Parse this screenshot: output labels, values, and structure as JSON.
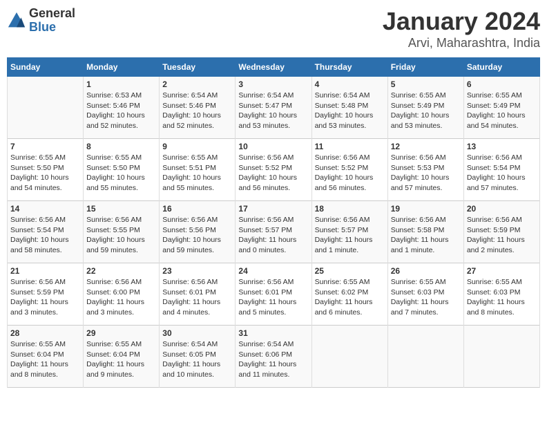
{
  "logo": {
    "general": "General",
    "blue": "Blue"
  },
  "title": "January 2024",
  "subtitle": "Arvi, Maharashtra, India",
  "days_header": [
    "Sunday",
    "Monday",
    "Tuesday",
    "Wednesday",
    "Thursday",
    "Friday",
    "Saturday"
  ],
  "weeks": [
    [
      {
        "day": "",
        "content": ""
      },
      {
        "day": "1",
        "content": "Sunrise: 6:53 AM\nSunset: 5:46 PM\nDaylight: 10 hours\nand 52 minutes."
      },
      {
        "day": "2",
        "content": "Sunrise: 6:54 AM\nSunset: 5:46 PM\nDaylight: 10 hours\nand 52 minutes."
      },
      {
        "day": "3",
        "content": "Sunrise: 6:54 AM\nSunset: 5:47 PM\nDaylight: 10 hours\nand 53 minutes."
      },
      {
        "day": "4",
        "content": "Sunrise: 6:54 AM\nSunset: 5:48 PM\nDaylight: 10 hours\nand 53 minutes."
      },
      {
        "day": "5",
        "content": "Sunrise: 6:55 AM\nSunset: 5:49 PM\nDaylight: 10 hours\nand 53 minutes."
      },
      {
        "day": "6",
        "content": "Sunrise: 6:55 AM\nSunset: 5:49 PM\nDaylight: 10 hours\nand 54 minutes."
      }
    ],
    [
      {
        "day": "7",
        "content": "Sunrise: 6:55 AM\nSunset: 5:50 PM\nDaylight: 10 hours\nand 54 minutes."
      },
      {
        "day": "8",
        "content": "Sunrise: 6:55 AM\nSunset: 5:50 PM\nDaylight: 10 hours\nand 55 minutes."
      },
      {
        "day": "9",
        "content": "Sunrise: 6:55 AM\nSunset: 5:51 PM\nDaylight: 10 hours\nand 55 minutes."
      },
      {
        "day": "10",
        "content": "Sunrise: 6:56 AM\nSunset: 5:52 PM\nDaylight: 10 hours\nand 56 minutes."
      },
      {
        "day": "11",
        "content": "Sunrise: 6:56 AM\nSunset: 5:52 PM\nDaylight: 10 hours\nand 56 minutes."
      },
      {
        "day": "12",
        "content": "Sunrise: 6:56 AM\nSunset: 5:53 PM\nDaylight: 10 hours\nand 57 minutes."
      },
      {
        "day": "13",
        "content": "Sunrise: 6:56 AM\nSunset: 5:54 PM\nDaylight: 10 hours\nand 57 minutes."
      }
    ],
    [
      {
        "day": "14",
        "content": "Sunrise: 6:56 AM\nSunset: 5:54 PM\nDaylight: 10 hours\nand 58 minutes."
      },
      {
        "day": "15",
        "content": "Sunrise: 6:56 AM\nSunset: 5:55 PM\nDaylight: 10 hours\nand 59 minutes."
      },
      {
        "day": "16",
        "content": "Sunrise: 6:56 AM\nSunset: 5:56 PM\nDaylight: 10 hours\nand 59 minutes."
      },
      {
        "day": "17",
        "content": "Sunrise: 6:56 AM\nSunset: 5:57 PM\nDaylight: 11 hours\nand 0 minutes."
      },
      {
        "day": "18",
        "content": "Sunrise: 6:56 AM\nSunset: 5:57 PM\nDaylight: 11 hours\nand 1 minute."
      },
      {
        "day": "19",
        "content": "Sunrise: 6:56 AM\nSunset: 5:58 PM\nDaylight: 11 hours\nand 1 minute."
      },
      {
        "day": "20",
        "content": "Sunrise: 6:56 AM\nSunset: 5:59 PM\nDaylight: 11 hours\nand 2 minutes."
      }
    ],
    [
      {
        "day": "21",
        "content": "Sunrise: 6:56 AM\nSunset: 5:59 PM\nDaylight: 11 hours\nand 3 minutes."
      },
      {
        "day": "22",
        "content": "Sunrise: 6:56 AM\nSunset: 6:00 PM\nDaylight: 11 hours\nand 3 minutes."
      },
      {
        "day": "23",
        "content": "Sunrise: 6:56 AM\nSunset: 6:01 PM\nDaylight: 11 hours\nand 4 minutes."
      },
      {
        "day": "24",
        "content": "Sunrise: 6:56 AM\nSunset: 6:01 PM\nDaylight: 11 hours\nand 5 minutes."
      },
      {
        "day": "25",
        "content": "Sunrise: 6:55 AM\nSunset: 6:02 PM\nDaylight: 11 hours\nand 6 minutes."
      },
      {
        "day": "26",
        "content": "Sunrise: 6:55 AM\nSunset: 6:03 PM\nDaylight: 11 hours\nand 7 minutes."
      },
      {
        "day": "27",
        "content": "Sunrise: 6:55 AM\nSunset: 6:03 PM\nDaylight: 11 hours\nand 8 minutes."
      }
    ],
    [
      {
        "day": "28",
        "content": "Sunrise: 6:55 AM\nSunset: 6:04 PM\nDaylight: 11 hours\nand 8 minutes."
      },
      {
        "day": "29",
        "content": "Sunrise: 6:55 AM\nSunset: 6:04 PM\nDaylight: 11 hours\nand 9 minutes."
      },
      {
        "day": "30",
        "content": "Sunrise: 6:54 AM\nSunset: 6:05 PM\nDaylight: 11 hours\nand 10 minutes."
      },
      {
        "day": "31",
        "content": "Sunrise: 6:54 AM\nSunset: 6:06 PM\nDaylight: 11 hours\nand 11 minutes."
      },
      {
        "day": "",
        "content": ""
      },
      {
        "day": "",
        "content": ""
      },
      {
        "day": "",
        "content": ""
      }
    ]
  ]
}
